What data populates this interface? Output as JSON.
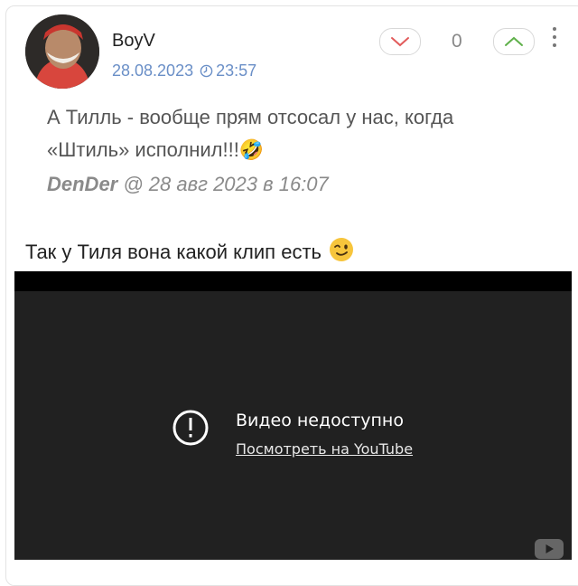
{
  "post": {
    "author": "BoyV",
    "date": "28.08.2023",
    "time": "23:57",
    "score": "0",
    "quote": {
      "text": "А Тилль - вообще прям отсосал у нас, когда «Штиль» исполнил!!!🤣",
      "author": "DenDer",
      "source_rest": " @ 28 авг 2023 в 16:07"
    },
    "text": "Так у Тиля вона какой клип есть",
    "icons": {
      "avatar": "avatar-photo",
      "clock": "clock-icon",
      "down": "chevron-down-icon",
      "up": "chevron-up-icon",
      "more": "kebab-menu-icon",
      "emoji": "wink-emoji"
    }
  },
  "video": {
    "title": "Видео недоступно",
    "link": "Посмотреть на YouTube",
    "icons": {
      "alert": "alert-circle-icon",
      "logo": "youtube-logo"
    }
  },
  "colors": {
    "accent": "#6a8fc7",
    "up": "#5fb04a",
    "down": "#e25b5b"
  }
}
